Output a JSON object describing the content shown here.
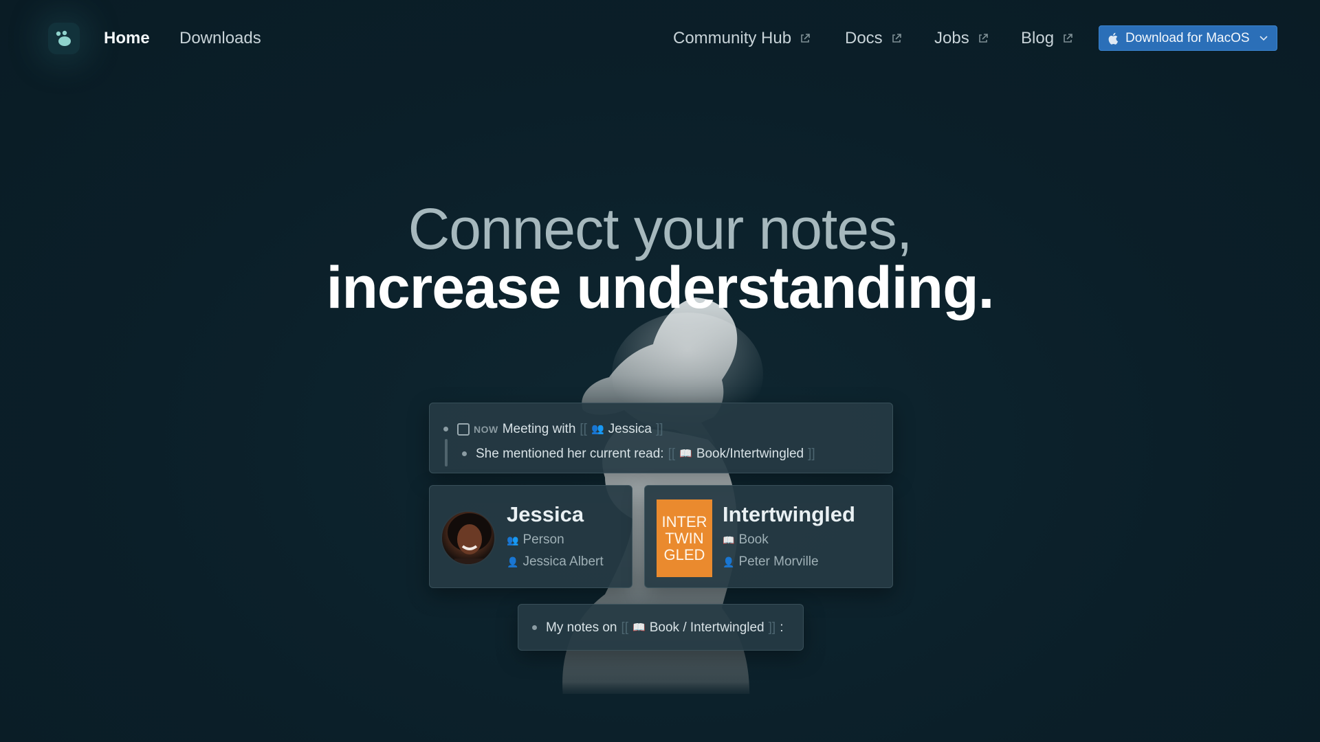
{
  "nav": {
    "home": "Home",
    "downloads": "Downloads",
    "links": [
      "Community Hub",
      "Docs",
      "Jobs",
      "Blog"
    ],
    "download_button": "Download for MacOS"
  },
  "hero": {
    "line1": "Connect your notes,",
    "line2": "increase understanding."
  },
  "top_card": {
    "row1": {
      "status": "NOW",
      "text": "Meeting with",
      "bracket_open": "[[",
      "link": "Jessica",
      "bracket_close": "]]"
    },
    "row2": {
      "text": "She mentioned her current read:",
      "bracket_open": "[[",
      "link": "Book/Intertwingled",
      "bracket_close": "]]"
    }
  },
  "person_card": {
    "title": "Jessica",
    "type": "Person",
    "full_name": "Jessica Albert"
  },
  "book_card": {
    "title": "Intertwingled",
    "type": "Book",
    "author": "Peter Morville",
    "cover_text": [
      "INTER",
      "TWIN",
      "GLED"
    ]
  },
  "notes_card": {
    "text": "My notes on",
    "bracket_open": "[[",
    "link": "Book / Intertwingled",
    "bracket_close": "]]",
    "suffix": ":"
  },
  "colors": {
    "background": "#0b1f29",
    "accent_button": "#2b6fb8",
    "book_cover": "#ea8a2e"
  }
}
